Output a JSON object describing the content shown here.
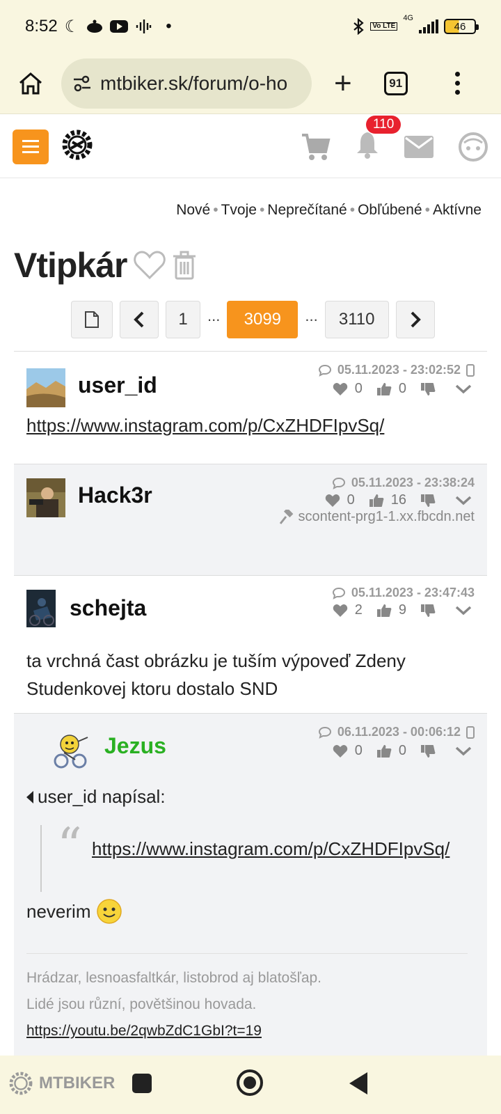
{
  "status": {
    "time": "8:52",
    "network": "4G",
    "lte": "Vo LTE",
    "battery": "46"
  },
  "browser": {
    "url": "mtbiker.sk/forum/o-ho",
    "tab_count": "91"
  },
  "header": {
    "notification_count": "110"
  },
  "forum_nav": [
    "Nové",
    "Tvoje",
    "Neprečítané",
    "Obľúbené",
    "Aktívne"
  ],
  "thread": {
    "title": "Vtipkár"
  },
  "pager": {
    "first": "1",
    "current": "3099",
    "last": "3110",
    "ellipsis": "..."
  },
  "posts": [
    {
      "user": "user_id",
      "date": "05.11.2023 - 23:02:52",
      "likes": "0",
      "thumbs": "0",
      "text": "https://www.instagram.com/p/CxZHDFIpvSq/"
    },
    {
      "user": "Hack3r",
      "date": "05.11.2023 - 23:38:24",
      "likes": "0",
      "thumbs": "16",
      "source": "scontent-prg1-1.xx.fbcdn.net"
    },
    {
      "user": "schejta",
      "date": "05.11.2023 - 23:47:43",
      "likes": "2",
      "thumbs": "9",
      "text": "ta vrchná čast obrázku je tuším výpoveď Zdeny Studenkovej ktoru dostalo SND"
    },
    {
      "user": "Jezus",
      "date": "06.11.2023 - 00:06:12",
      "likes": "0",
      "thumbs": "0",
      "quote_header": "user_id napísal:",
      "quote_text": "https://www.instagram.com/p/CxZHDFIpvSq/",
      "reply": "neverim",
      "signature": [
        "Hrádzar, lesnoasfaltkár, listobrod aj blatošľap.",
        "Lidé jsou různí, povětšinou hovada.",
        "https://youtu.be/2qwbZdC1GbI?t=19"
      ]
    }
  ],
  "watermark": "MTBIKER",
  "colors": {
    "accent": "#f7941d",
    "badge": "#e8212e",
    "username_green": "#2ab022",
    "browser_bg": "#f9f6e0"
  }
}
